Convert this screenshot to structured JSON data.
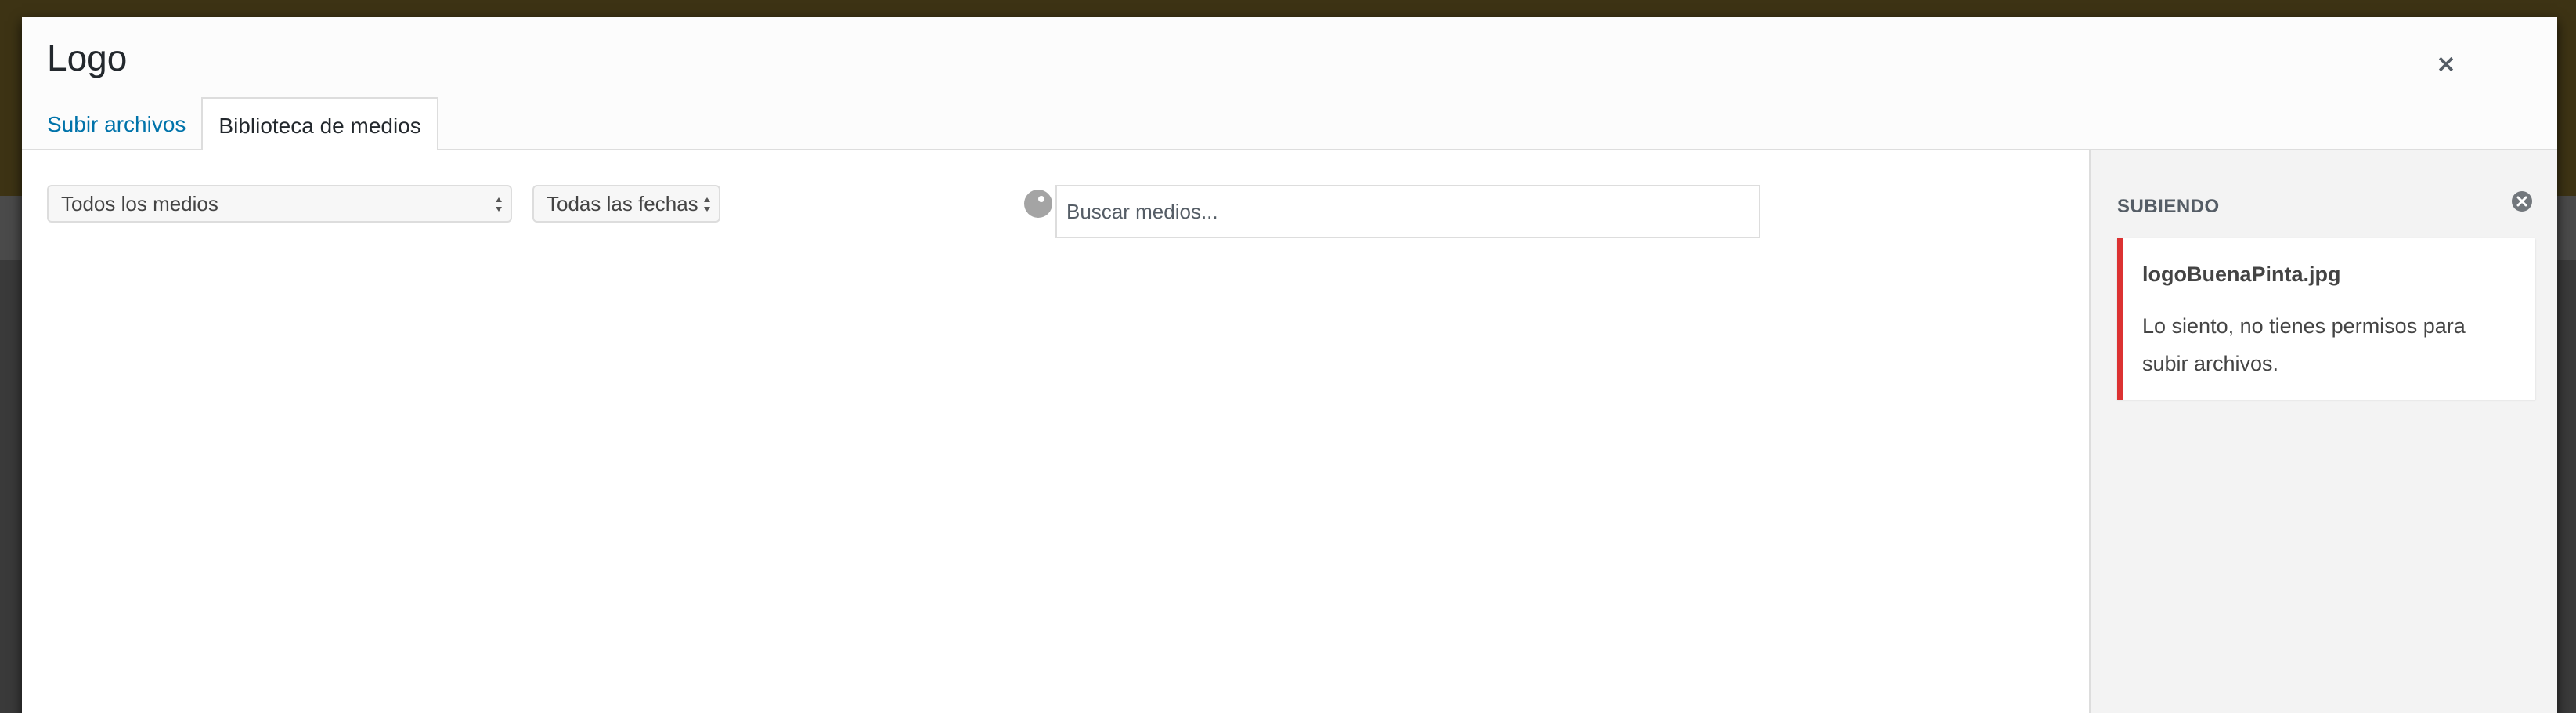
{
  "modal": {
    "title": "Logo",
    "close_icon": "close-icon"
  },
  "tabs": [
    {
      "label": "Subir archivos",
      "active": false
    },
    {
      "label": "Biblioteca de medios",
      "active": true
    }
  ],
  "toolbar": {
    "media_filter": "Todos los medios",
    "date_filter": "Todas las fechas",
    "search_placeholder": "Buscar medios..."
  },
  "sidebar": {
    "title": "SUBIENDO",
    "dismiss_icon": "dismiss-circle-icon",
    "error": {
      "filename": "logoBuenaPinta.jpg",
      "message": "Lo siento, no tienes permisos para subir archivos."
    }
  },
  "colors": {
    "link": "#0073aa",
    "error_accent": "#dc3232",
    "sidebar_bg": "#f3f3f3"
  }
}
